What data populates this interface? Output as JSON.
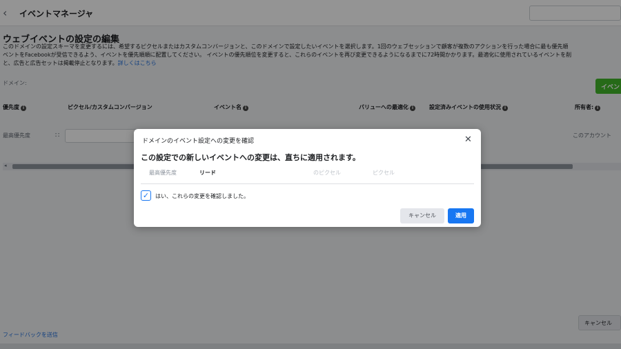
{
  "topbar": {
    "back_icon": "chevron-left-icon",
    "title": "イベントマネージャ"
  },
  "page": {
    "heading": "ウェブイベントの設定の編集",
    "desc_line1": "このドメインの設定スキーマを変更するには、希望するピクセルまたはカスタムコンバージョンと、このドメインで設定したいイベントを選択します。1回のウェブセッションで顧客が複数のアクションを行った場合に最も優先順",
    "desc_line2": "ベントをFacebookが受信できるよう、イベントを優先順順に配置してください。 イベントの優先順位を変更すると、これらのイベントを再び変更できるようになるまでに72時間かかります。最適化に使用されているイベントを削",
    "desc_line3_prefix": "と、広告と広告セットは掲載停止となります。",
    "desc_link": "詳しくはこちら",
    "domain_label": "ドメイン:",
    "green_button": "イベン"
  },
  "table": {
    "headers": {
      "priority": "優先度",
      "pixel": "ピクセル/カスタムコンバージョン",
      "event": "イベント名",
      "value": "バリューへの最適化",
      "status": "設定済みイベントの使用状況",
      "owner": "所有者:"
    },
    "row": {
      "priority": "最高優先度",
      "account": "このアカウント"
    }
  },
  "footer": {
    "feedback": "フィードバックを送信",
    "cancel": "キャンセル"
  },
  "dialog": {
    "title": "ドメインのイベント設定への変更を確認",
    "heading": "この設定での新しいイベントへの変更は、直ちに適用されます。",
    "row": {
      "priority": "最高優先度",
      "event": "リード",
      "pixel1": "のピクセル",
      "pixel2": "ピクセル"
    },
    "checkbox_checked": true,
    "confirm_label": "はい、これらの変更を確認しました。",
    "cancel_label": "キャンセル",
    "apply_label": "適用"
  },
  "colors": {
    "primary": "#1877f2",
    "green": "#42b72a",
    "link": "#216fdb"
  }
}
